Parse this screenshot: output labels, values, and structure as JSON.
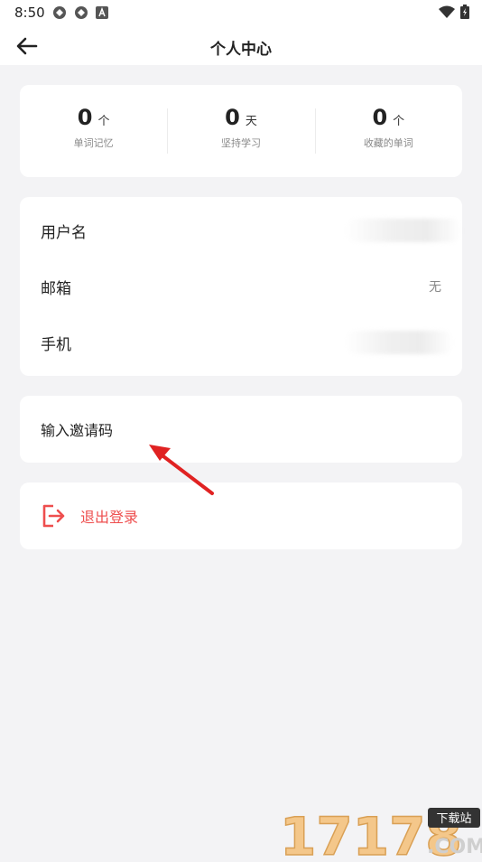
{
  "status": {
    "time": "8:50"
  },
  "header": {
    "title": "个人中心"
  },
  "stats": [
    {
      "value": "0",
      "unit": "个",
      "label": "单词记忆"
    },
    {
      "value": "0",
      "unit": "天",
      "label": "坚持学习"
    },
    {
      "value": "0",
      "unit": "个",
      "label": "收藏的单词"
    }
  ],
  "info": {
    "username_label": "用户名",
    "email_label": "邮箱",
    "email_value": "无",
    "phone_label": "手机"
  },
  "invite": {
    "label": "输入邀请码"
  },
  "logout": {
    "label": "退出登录"
  },
  "watermark": {
    "digits": "17178",
    "badge": "下载站",
    "domain": ".COM"
  },
  "colors": {
    "accent_red": "#ee4e4e",
    "background": "#f3f3f5",
    "card": "#ffffff"
  }
}
